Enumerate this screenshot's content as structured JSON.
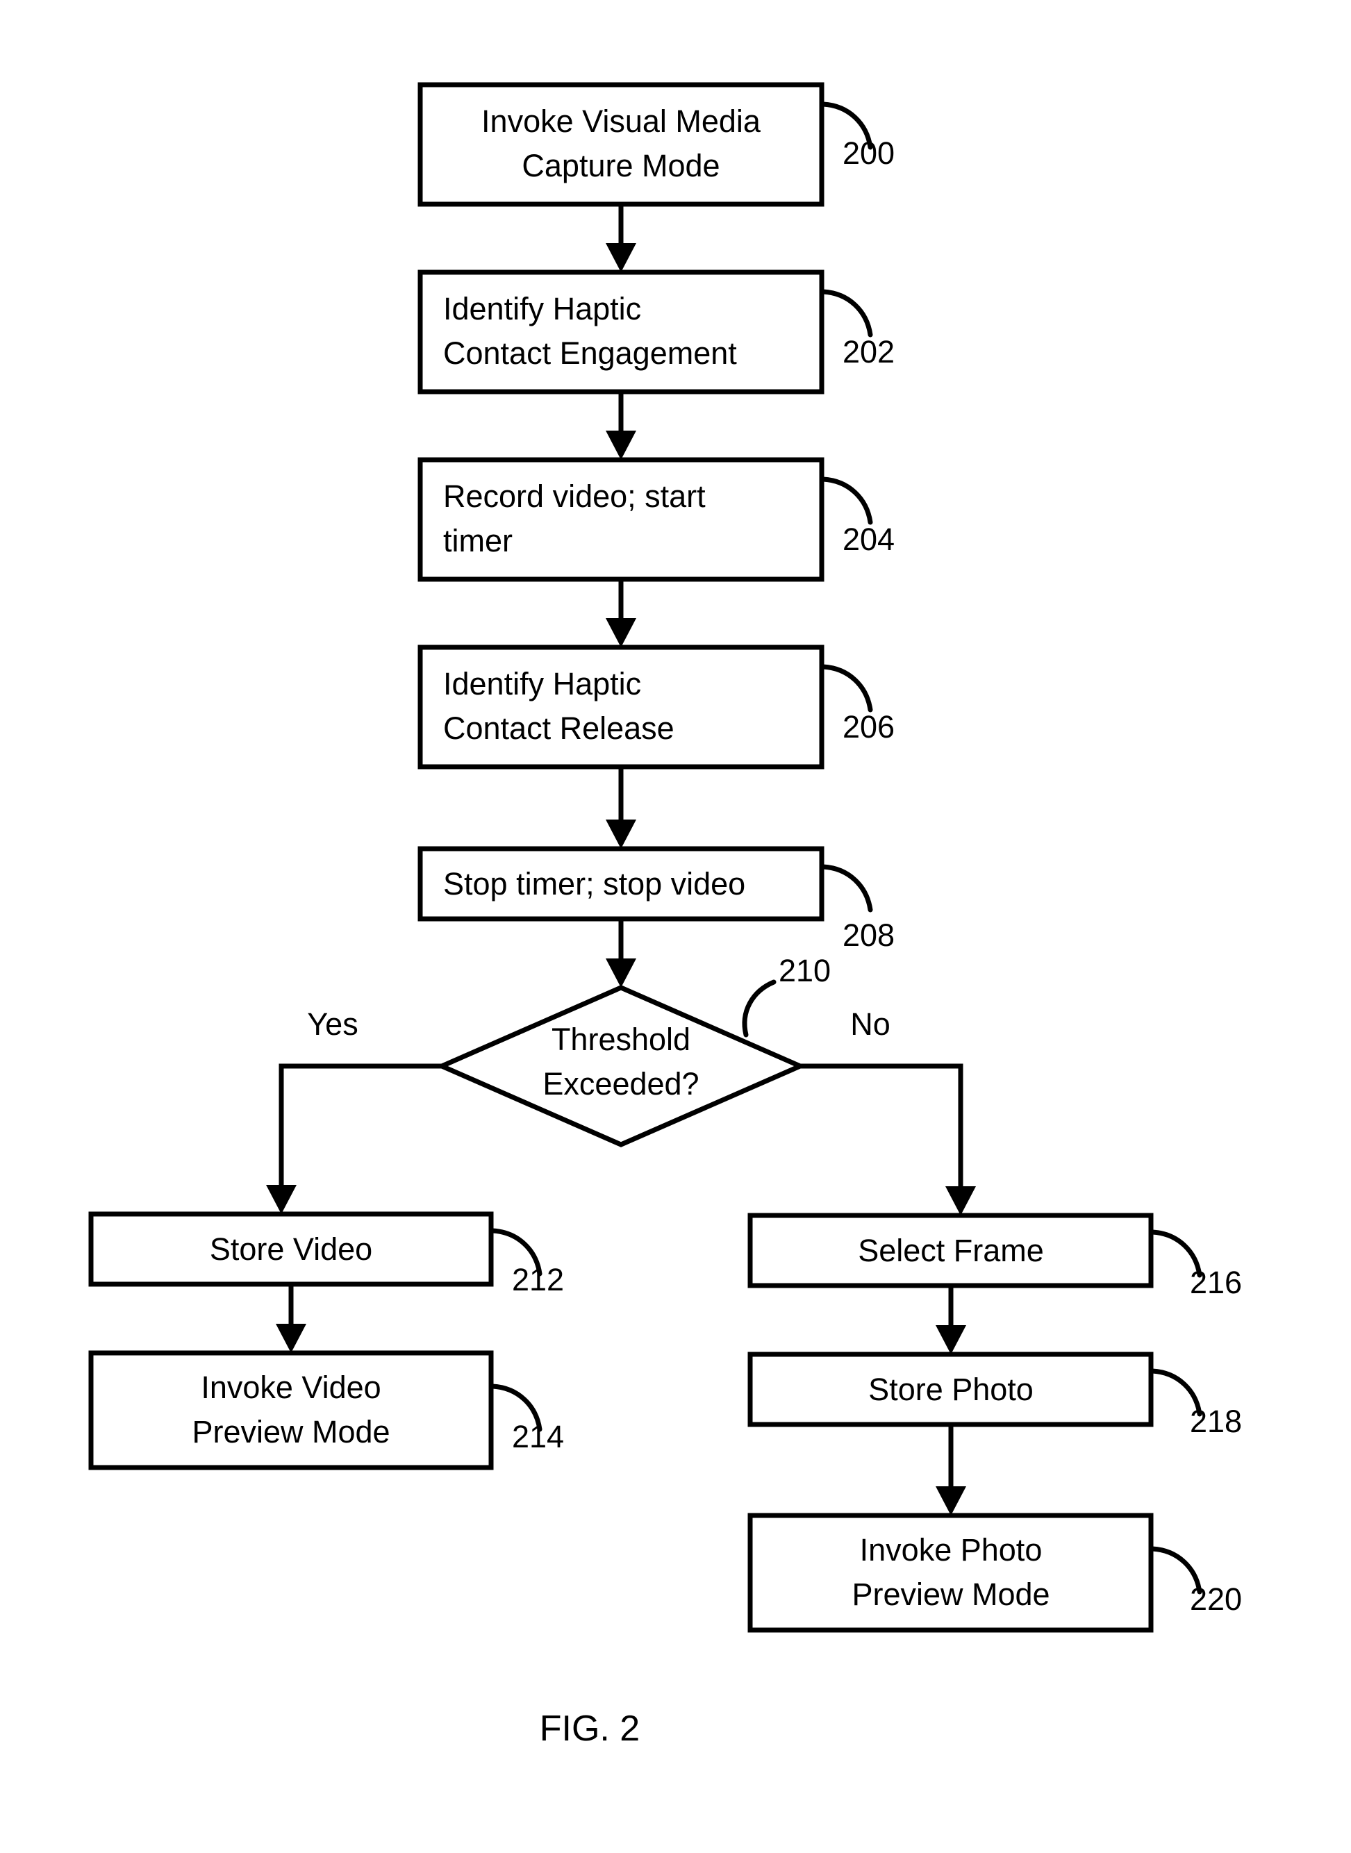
{
  "figure": {
    "caption": "FIG. 2"
  },
  "nodes": [
    {
      "ref": "200",
      "shape": "process",
      "align": "center",
      "lines": [
        "Invoke Visual Media",
        "Capture Mode"
      ]
    },
    {
      "ref": "202",
      "shape": "process",
      "align": "left",
      "lines": [
        "Identify Haptic",
        "Contact Engagement"
      ]
    },
    {
      "ref": "204",
      "shape": "process",
      "align": "left",
      "lines": [
        "Record video; start",
        "timer"
      ]
    },
    {
      "ref": "206",
      "shape": "process",
      "align": "left",
      "lines": [
        "Identify Haptic",
        "Contact Release"
      ]
    },
    {
      "ref": "208",
      "shape": "process",
      "align": "left",
      "lines": [
        "Stop timer; stop video"
      ]
    },
    {
      "ref": "210",
      "shape": "decision",
      "align": "center",
      "lines": [
        "Threshold",
        "Exceeded?"
      ]
    },
    {
      "ref": "212",
      "shape": "process",
      "align": "center",
      "lines": [
        "Store Video"
      ]
    },
    {
      "ref": "214",
      "shape": "process",
      "align": "center",
      "lines": [
        "Invoke Video",
        "Preview Mode"
      ]
    },
    {
      "ref": "216",
      "shape": "process",
      "align": "center",
      "lines": [
        "Select Frame"
      ]
    },
    {
      "ref": "218",
      "shape": "process",
      "align": "center",
      "lines": [
        "Store Photo"
      ]
    },
    {
      "ref": "220",
      "shape": "process",
      "align": "center",
      "lines": [
        "Invoke Photo",
        "Preview Mode"
      ]
    }
  ],
  "branches": {
    "yes_label": "Yes",
    "no_label": "No"
  },
  "colors": {
    "stroke": "#000000",
    "fill": "#ffffff",
    "text": "#000000"
  }
}
